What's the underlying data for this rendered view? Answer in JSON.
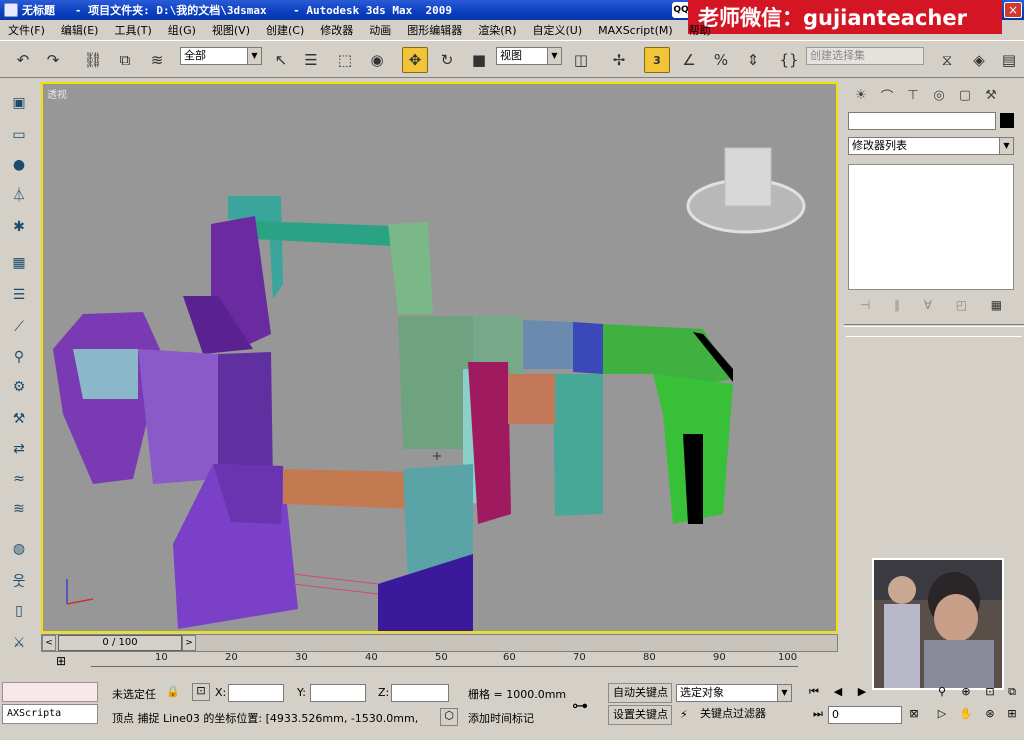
{
  "titlebar": {
    "title": "无标题   - 项目文件夹: D:\\我的文档\\3dsmax    - Autodesk 3ds Max  2009",
    "qq_label": "QQ",
    "close_glyph": "×"
  },
  "watermark": {
    "text": "老师微信：gujianteacher"
  },
  "menu": {
    "items": [
      "文件(F)",
      "编辑(E)",
      "工具(T)",
      "组(G)",
      "视图(V)",
      "创建(C)",
      "修改器",
      "动画",
      "图形编辑器",
      "渲染(R)",
      "自定义(U)",
      "MAXScript(M)",
      "帮助"
    ]
  },
  "toolbar": {
    "selection_filter": "全部",
    "ref_coord": "视图",
    "named_selection_placeholder": "创建选择集",
    "active_tool": "move",
    "snap_label": "3"
  },
  "left_toolbar": {
    "icons": [
      "viewport-icon",
      "box-icon",
      "sphere-icon",
      "light-icon",
      "helper-icon",
      "checker-icon",
      "layers-icon",
      "bone-icon",
      "search-icon",
      "gear-icon",
      "wrench-icon",
      "arrow-icon",
      "wave-icon",
      "globe-icon",
      "biped-icon",
      "bottle-icon",
      "tools-icon"
    ]
  },
  "viewport": {
    "label": "透视",
    "border_color": "#f2e000",
    "background": "#979797"
  },
  "command_panel": {
    "tabs": [
      "create-icon",
      "modify-icon",
      "hierarchy-icon",
      "motion-icon",
      "display-icon",
      "utilities-icon"
    ],
    "name_value": "",
    "object_color": "#000000",
    "modifier_list": "修改器列表"
  },
  "time_slider": {
    "position": "0 / 100",
    "prev": "<",
    "next": ">"
  },
  "track_bar": {
    "labels": [
      "10",
      "20",
      "30",
      "40",
      "50",
      "60",
      "70",
      "80",
      "90",
      "100"
    ]
  },
  "status_bar": {
    "maxscript_label": "AXScripta",
    "selection_status": "未选定任",
    "x_label": "X:",
    "y_label": "Y:",
    "z_label": "Z:",
    "x_value": "",
    "y_value": "",
    "z_value": "",
    "grid": "栅格 = 1000.0mm",
    "prompt": "顶点 捕捉 Line03 的坐标位置:  [4933.526mm, -1530.0mm,",
    "add_time_tag": "添加时间标记",
    "auto_key": "自动关键点",
    "set_key": "设置关键点",
    "key_mode": "选定对象",
    "key_filters": "关键点过滤器",
    "frame": "0"
  }
}
